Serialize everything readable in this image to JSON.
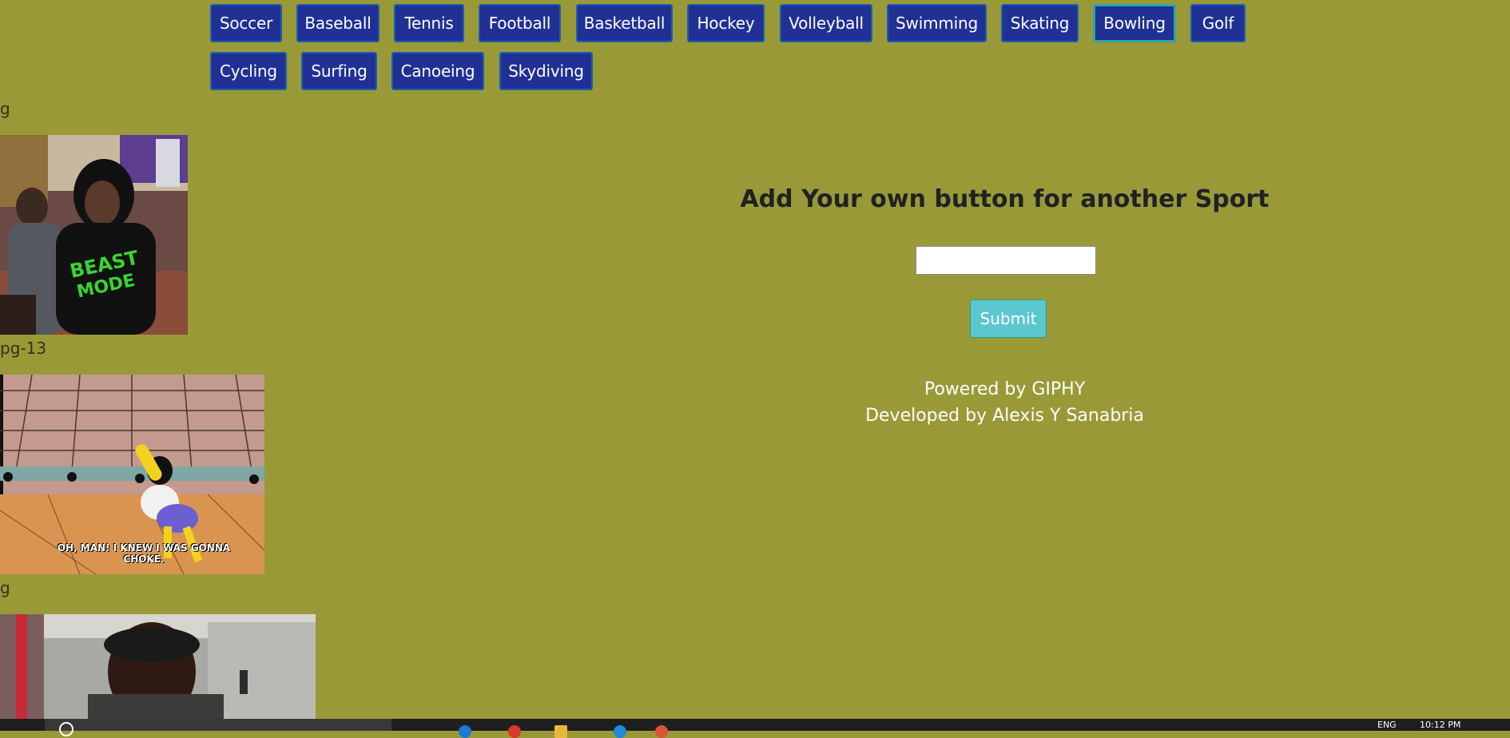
{
  "sports": [
    {
      "label": "Soccer",
      "active": false
    },
    {
      "label": "Baseball",
      "active": false
    },
    {
      "label": "Tennis",
      "active": false
    },
    {
      "label": "Football",
      "active": false
    },
    {
      "label": "Basketball",
      "active": false
    },
    {
      "label": "Hockey",
      "active": false
    },
    {
      "label": "Volleyball",
      "active": false
    },
    {
      "label": "Swimming",
      "active": false
    },
    {
      "label": "Skating",
      "active": false
    },
    {
      "label": "Bowling",
      "active": true
    },
    {
      "label": "Golf",
      "active": false
    },
    {
      "label": "Cycling",
      "active": false
    },
    {
      "label": "Surfing",
      "active": false
    },
    {
      "label": "Canoeing",
      "active": false
    },
    {
      "label": "Skydiving",
      "active": false
    }
  ],
  "gifs": [
    {
      "rating": "g",
      "caption": "",
      "icon": "bowling-beast-mode-gif"
    },
    {
      "rating": "pg-13",
      "caption": "OH, MAN! I KNEW I WAS GONNA CHOKE.",
      "icon": "simpsons-bowling-gif"
    },
    {
      "rating": "g",
      "caption": "",
      "icon": "bowling-alley-man-gif"
    }
  ],
  "add_form": {
    "title": "Add Your own button for another Sport",
    "input_value": "",
    "input_placeholder": "",
    "submit_label": "Submit"
  },
  "credits": {
    "powered_by": "Powered by GIPHY",
    "developed_by": "Developed by Alexis Y Sanabria"
  },
  "taskbar": {
    "language": "ENG",
    "time": "10:12 PM"
  },
  "colors": {
    "page_background": "#999a37",
    "sport_button": "#213094",
    "submit_button": "#5bc7cf"
  }
}
